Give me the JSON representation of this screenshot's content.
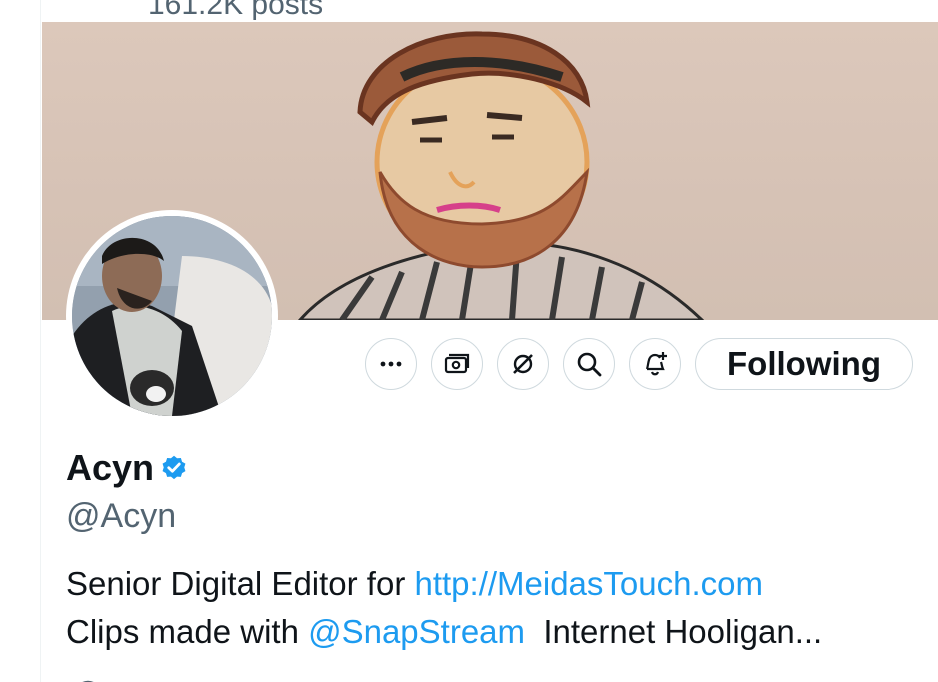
{
  "header": {
    "posts_count": "161.2K posts"
  },
  "profile": {
    "display_name": "Acyn",
    "handle": "@Acyn",
    "verified": true,
    "following_label": "Following",
    "bio": {
      "line1_text": "Senior Digital Editor for ",
      "line1_link": "http://MeidasTouch.com",
      "line2_text": "Clips made with ",
      "line2_mention": "@SnapStream",
      "line2_tail": "  Internet Hooligan..."
    }
  },
  "actions": {
    "more": "more-icon",
    "subscriptions": "money-icon",
    "grok": "grok-icon",
    "search": "search-icon",
    "notifications": "bell-plus-icon"
  },
  "colors": {
    "accent": "#1d9bf0",
    "text": "#0f1419",
    "muted": "#536471",
    "border": "#cfd9de"
  }
}
